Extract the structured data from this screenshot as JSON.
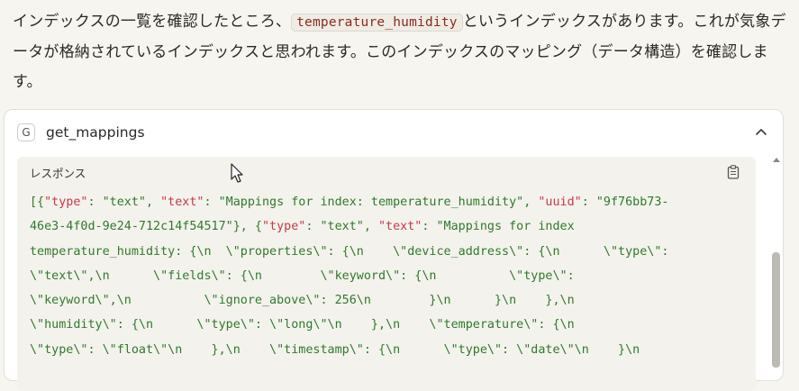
{
  "intro": {
    "text_before": "インデックスの一覧を確認したところ、",
    "code": "temperature_humidity",
    "text_after": "というインデックスがあります。これが気象データが格納されているインデックスと思われます。このインデックスのマッピング（データ構造）を確認します。"
  },
  "tool": {
    "icon_letter": "G",
    "name": "get_mappings"
  },
  "response": {
    "label": "レスポンス",
    "lines": [
      "[{\"type\": \"text\", \"text\": \"Mappings for index: temperature_humidity\", \"uuid\": \"9f76bb73-",
      "46e3-4f0d-9e24-712c14f54517\"}, {\"type\": \"text\", \"text\": \"Mappings for index",
      "temperature_humidity: {\\n  \\\"properties\\\": {\\n    \\\"device_address\\\": {\\n      \\\"type\\\":",
      "\\\"text\\\",\\n      \\\"fields\\\": {\\n        \\\"keyword\\\": {\\n          \\\"type\\\":",
      "\\\"keyword\\\",\\n          \\\"ignore_above\\\": 256\\n        }\\n      }\\n    },\\n",
      "\\\"humidity\\\": {\\n      \\\"type\\\": \\\"long\\\"\\n    },\\n    \\\"temperature\\\": {\\n",
      "\\\"type\\\": \\\"float\\\"\\n    },\\n    \\\"timestamp\\\": {\\n      \\\"type\\\": \\\"date\\\"\\n    }\\n"
    ]
  },
  "icons": {
    "collapse": "chevron-up-icon",
    "copy": "clipboard-icon"
  }
}
